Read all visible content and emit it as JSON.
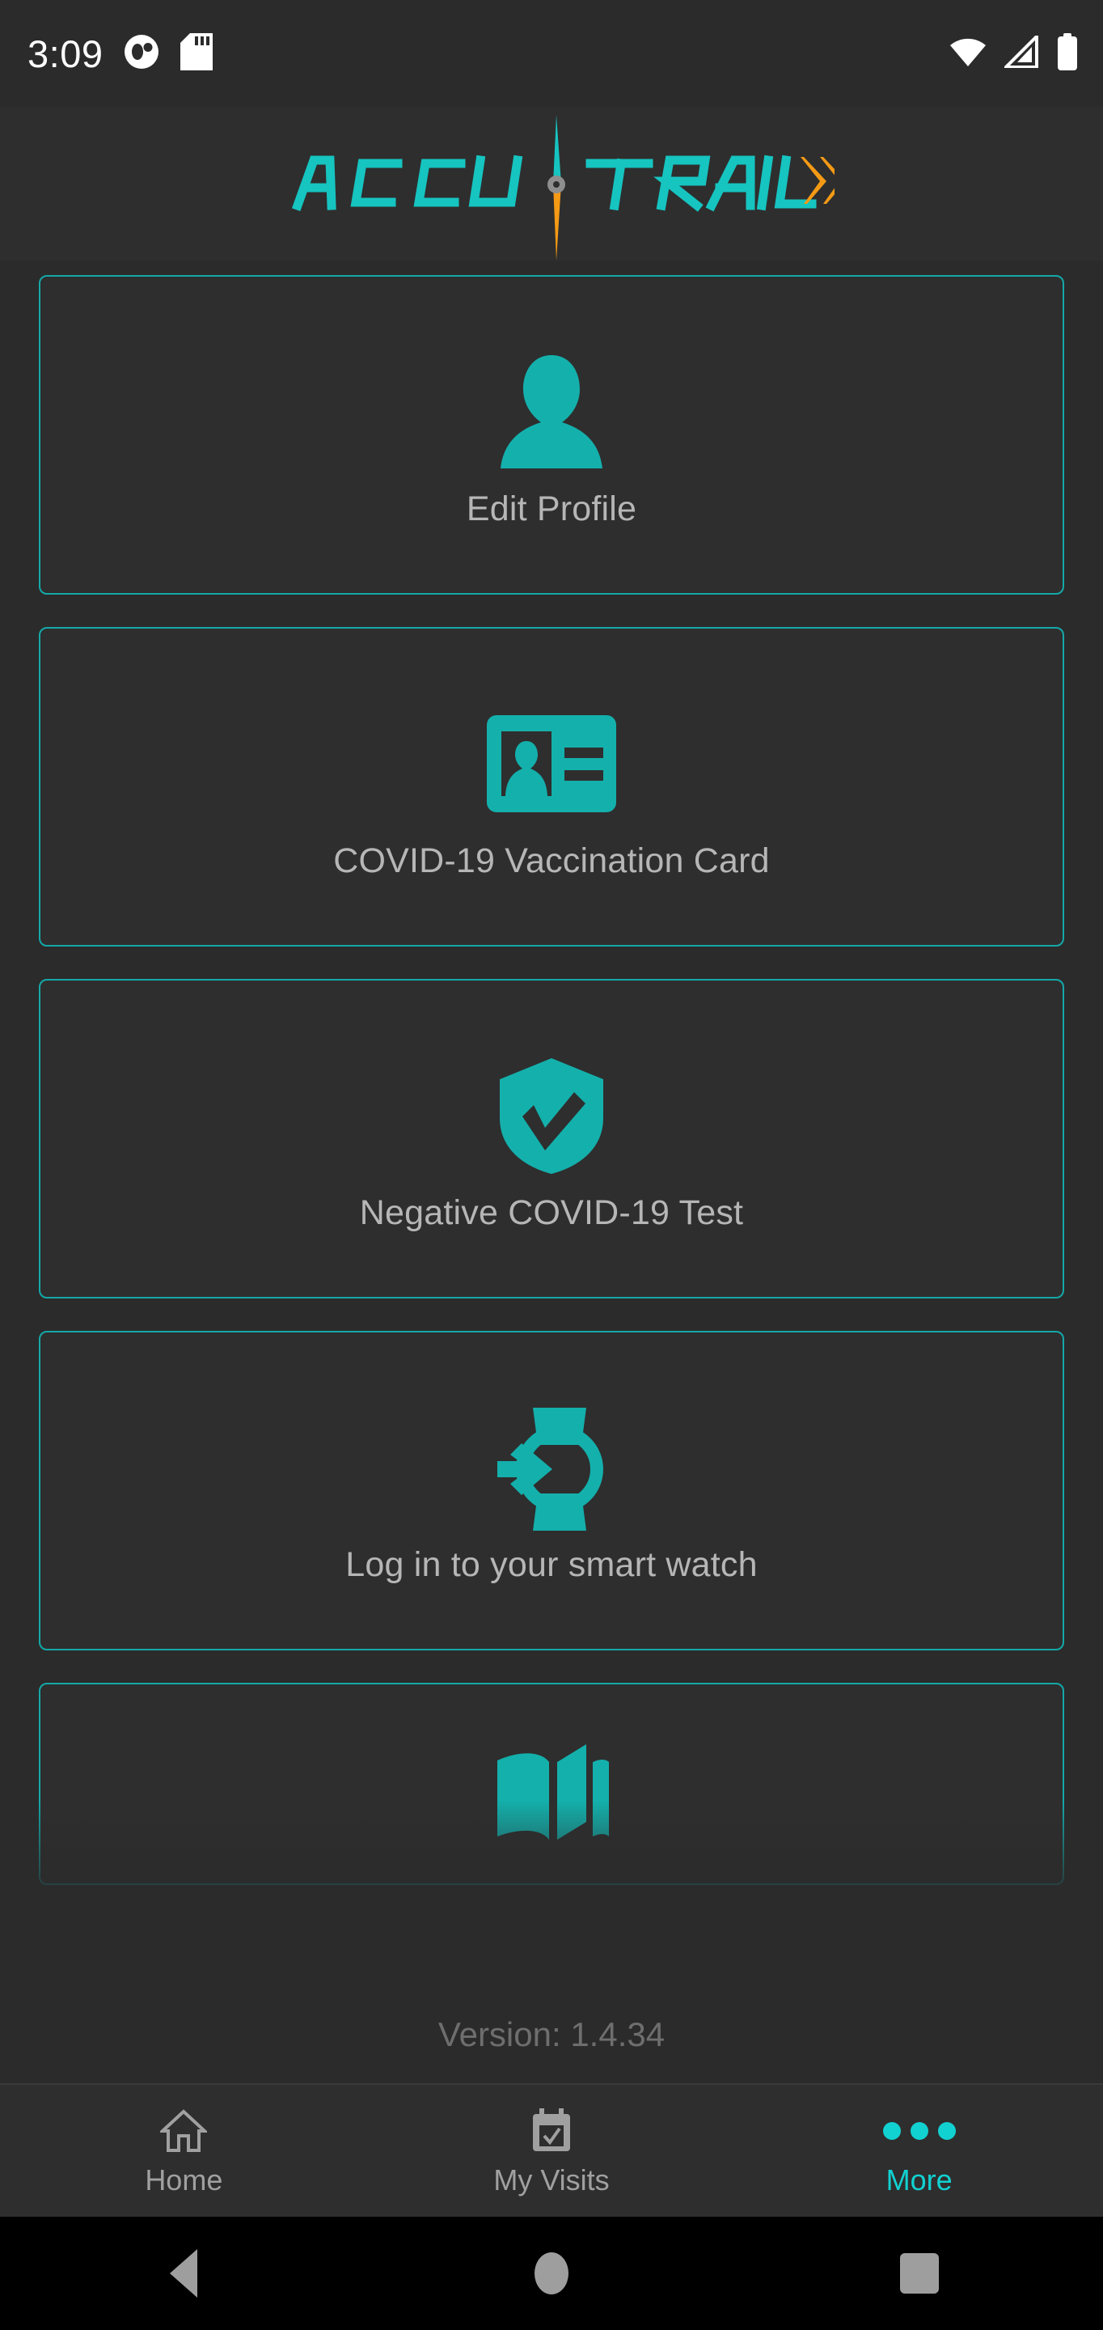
{
  "status_bar": {
    "time": "3:09",
    "left_icons": [
      "contact-circle-icon",
      "sd-card-icon"
    ],
    "right_icons": [
      "wifi-icon",
      "cellular-signal-icon",
      "battery-icon"
    ]
  },
  "header": {
    "logo_text_primary": "ACCU",
    "logo_text_secondary": "TRAIL",
    "logo_accent_color": "#16c4c0",
    "logo_needle_color": "#f59a15"
  },
  "theme": {
    "background": "#2b2b2b",
    "card_background": "#2e2e2e",
    "accent": "#14a8a8",
    "accent_bright": "#12d1d1",
    "label_text": "#b6b6b6",
    "muted_text": "#6e6e6e"
  },
  "menu": {
    "cards": [
      {
        "label": "Edit Profile",
        "icon": "person-icon"
      },
      {
        "label": "COVID-19 Vaccination Card",
        "icon": "id-card-icon"
      },
      {
        "label": "Negative COVID-19 Test",
        "icon": "shield-check-icon"
      },
      {
        "label": "Log in to your smart watch",
        "icon": "smart-watch-login-icon"
      },
      {
        "label": "",
        "icon": "open-book-icon"
      }
    ]
  },
  "footer": {
    "version": "Version: 1.4.34"
  },
  "bottom_nav": {
    "items": [
      {
        "label": "Home",
        "icon": "home-icon",
        "active": false
      },
      {
        "label": "My Visits",
        "icon": "calendar-check-icon",
        "active": false
      },
      {
        "label": "More",
        "icon": "more-dots-icon",
        "active": true
      }
    ]
  },
  "system_nav": {
    "back": "back-triangle-icon",
    "home": "home-circle-icon",
    "recents": "recents-square-icon"
  }
}
